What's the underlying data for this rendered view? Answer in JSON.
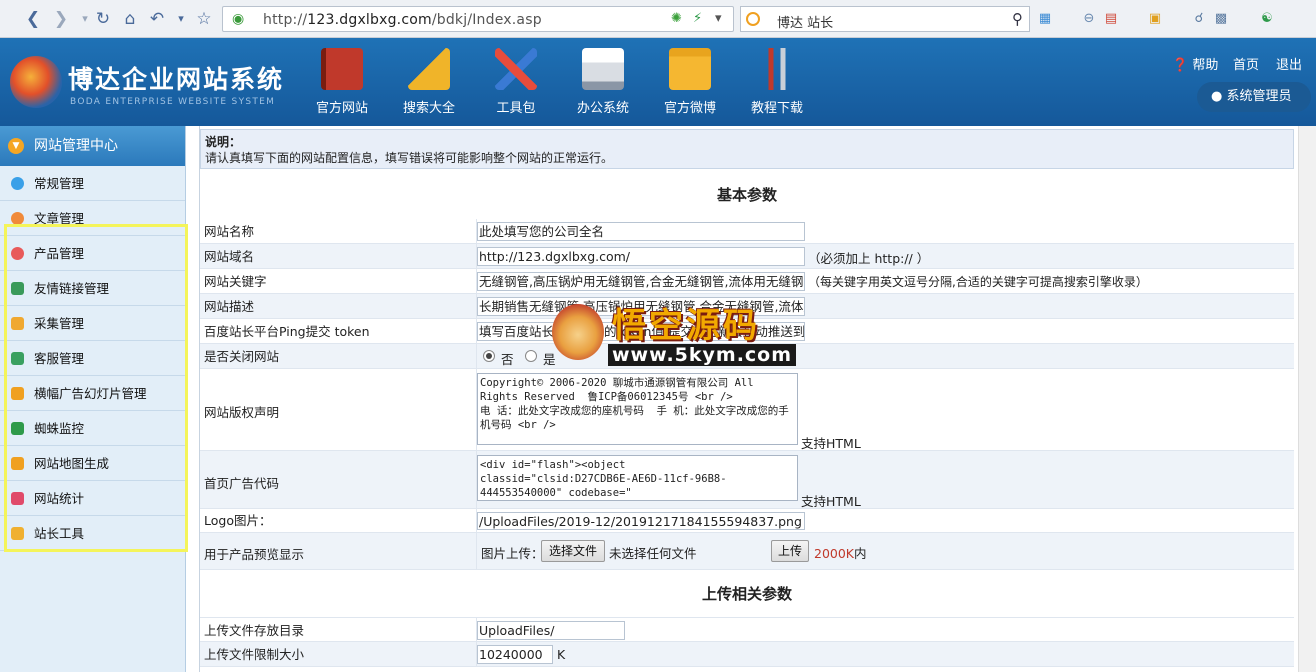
{
  "browser": {
    "url_prefix": "http://",
    "url_host": "123.dgxlbxg.com",
    "url_path": "/bdkj/Index.asp",
    "search_query": "博达 站长"
  },
  "header": {
    "brand": "博达企业网站系统",
    "brand_sub": "BODA ENTERPRISE WEBSITE SYSTEM",
    "nav": [
      {
        "label": "官方网站",
        "icon": "book-icon",
        "color": "#c0392b"
      },
      {
        "label": "搜索大全",
        "icon": "ruler-icon",
        "color": "#f0b429"
      },
      {
        "label": "工具包",
        "icon": "tools-icon",
        "color": "#e74c3c"
      },
      {
        "label": "办公系统",
        "icon": "printer-icon",
        "color": "#d9dde3"
      },
      {
        "label": "官方微博",
        "icon": "download-folder-icon",
        "color": "#f5b731"
      },
      {
        "label": "教程下载",
        "icon": "wrench-icon",
        "color": "#c8cfd8"
      }
    ],
    "help": "帮助",
    "home": "首页",
    "logout": "退出",
    "user": "系统管理员"
  },
  "sidebar": {
    "title": "网站管理中心",
    "items": [
      {
        "label": "常规管理",
        "color": "#3aa0e8"
      },
      {
        "label": "文章管理",
        "color": "#f08a3a"
      },
      {
        "label": "产品管理",
        "color": "#e85a5a"
      },
      {
        "label": "友情链接管理",
        "color": "#3a9a5a"
      },
      {
        "label": "采集管理",
        "color": "#f0a830"
      },
      {
        "label": "客服管理",
        "color": "#3aa060"
      },
      {
        "label": "横幅广告幻灯片管理",
        "color": "#f0a020"
      },
      {
        "label": "蜘蛛监控",
        "color": "#2e9a4a"
      },
      {
        "label": "网站地图生成",
        "color": "#f0a020"
      },
      {
        "label": "网站统计",
        "color": "#e04a6a"
      },
      {
        "label": "站长工具",
        "color": "#f0b030"
      }
    ]
  },
  "note": {
    "title": "说明：",
    "text": "请认真填写下面的网站配置信息，填写错误将可能影响整个网站的正常运行。"
  },
  "basic": {
    "title": "基本参数",
    "site_name_label": "网站名称",
    "site_name": "此处填写您的公司全名",
    "domain_label": "网站域名",
    "domain": "http://123.dgxlbxg.com/",
    "domain_hint": "（必须加上 http:// ）",
    "keywords_label": "网站关键字",
    "keywords": "无缝钢管,高压锅炉用无缝钢管,合金无缝钢管,流体用无缝钢管,",
    "keywords_hint": "（每关键字用英文逗号分隔,合适的关键字可提高搜索引擎收录）",
    "desc_label": "网站描述",
    "desc": "长期销售无缝钢管,高压锅炉用无缝钢管,合金无缝钢管,流体用无缝钢管",
    "ping_label": "百度站长平台Ping提交 token",
    "ping": "填写百度站长平台提交的token值,提交后更新会自动推送到百度",
    "close_label": "是否关闭网站",
    "close_no": "否",
    "close_yes": "是",
    "copyright_label": "网站版权声明",
    "copyright": "Copyright© 2006-2020 聊城市通源钢管有限公司 All Rights Reserved  鲁ICP备06012345号 <br />\n电 话：此处文字改成您的座机号码  手 机：此处文字改成您的手机号码 <br />",
    "html_support": "支持HTML",
    "ad_label": "首页广告代码",
    "ad": "<div id=\"flash\"><object classid=\"clsid:D27CDB6E-AE6D-11cf-96B8-444553540000\" codebase=\"\nhttp://download.macromedia.com/pub/shockwave/cabs/",
    "logo_label": "Logo图片：",
    "logo": "/UploadFiles/2019-12/20191217184155594837.png",
    "preview_label": "用于产品预览显示",
    "upload_label": "图片上传：",
    "choose_file": "选择文件",
    "no_file": "未选择任何文件",
    "upload_btn": "上传",
    "size_limit": "2000K",
    "size_suffix": "内"
  },
  "upload": {
    "title": "上传相关参数",
    "dir_label": "上传文件存放目录",
    "dir": "UploadFiles/",
    "limit_label": "上传文件限制大小",
    "limit": "10240000",
    "limit_unit": "K"
  },
  "watermark": {
    "title": "悟空源码",
    "url": "www.5kym.com"
  }
}
